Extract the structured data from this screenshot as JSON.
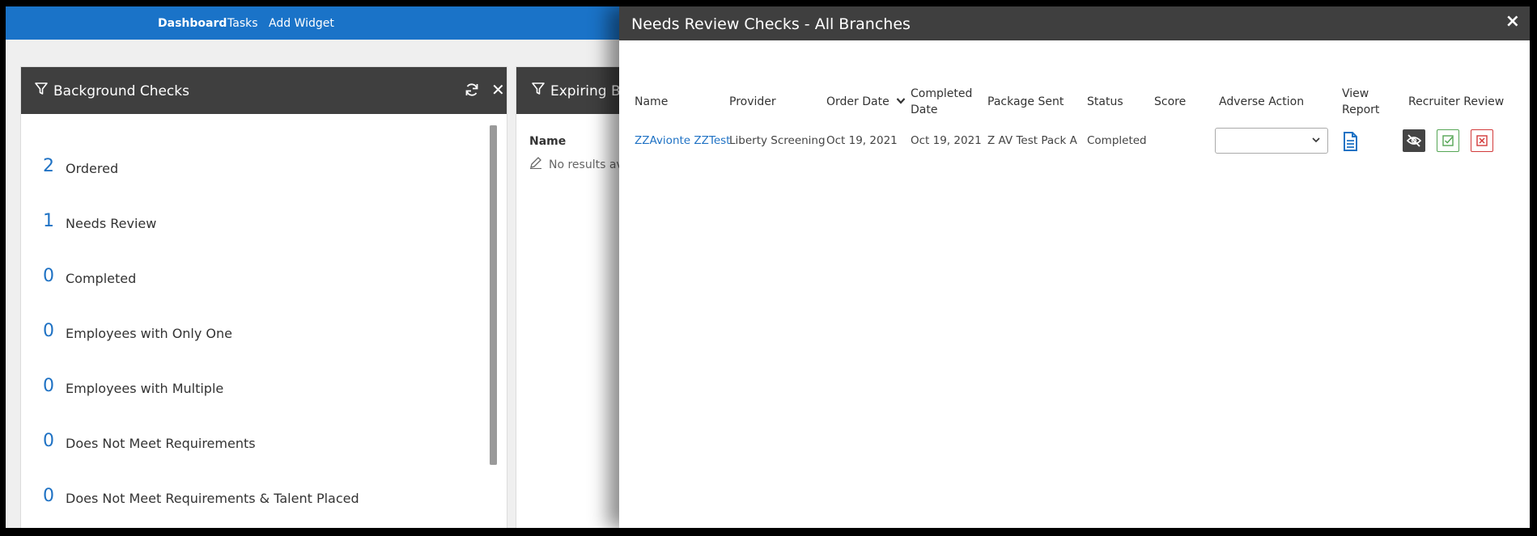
{
  "nav": {
    "dashboard": "Dashboard",
    "tasks": "Tasks",
    "add_widget": "Add Widget"
  },
  "widget_background": {
    "title": "Background Checks",
    "icons": [
      "filter-icon",
      "refresh-icon",
      "close-icon"
    ],
    "stats": [
      {
        "count": "2",
        "label": "Ordered"
      },
      {
        "count": "1",
        "label": "Needs Review"
      },
      {
        "count": "0",
        "label": "Completed"
      },
      {
        "count": "0",
        "label": "Employees with Only One"
      },
      {
        "count": "0",
        "label": "Employees with Multiple"
      },
      {
        "count": "0",
        "label": "Does Not Meet Requirements"
      },
      {
        "count": "0",
        "label": "Does Not Meet Requirements & Talent Placed"
      }
    ]
  },
  "widget_expiring": {
    "title": "Expiring Bac",
    "column_name": "Name",
    "no_results": "No results ava"
  },
  "panel": {
    "title": "Needs Review Checks - All Branches",
    "close": "×",
    "columns": {
      "name": "Name",
      "provider": "Provider",
      "order_date": "Order Date",
      "completed_date_1": "Completed",
      "completed_date_2": "Date",
      "package_sent": "Package Sent",
      "status": "Status",
      "score": "Score",
      "adverse_action": "Adverse Action",
      "view_report_1": "View",
      "view_report_2": "Report",
      "recruiter_review": "Recruiter Review"
    },
    "rows": [
      {
        "name": "ZZAvionte ZZTest",
        "provider": "Liberty Screening",
        "order_date": "Oct 19, 2021",
        "completed_date": "Oct 19, 2021",
        "package_sent": "Z AV Test Pack A",
        "status": "Completed",
        "score": "",
        "adverse_action": ""
      }
    ]
  },
  "colors": {
    "nav_blue": "#1a73c8",
    "header_dark": "#3f3f3f",
    "accent_blue": "#1f72c4",
    "approve_green": "#55a655",
    "reject_red": "#d23a3a"
  }
}
